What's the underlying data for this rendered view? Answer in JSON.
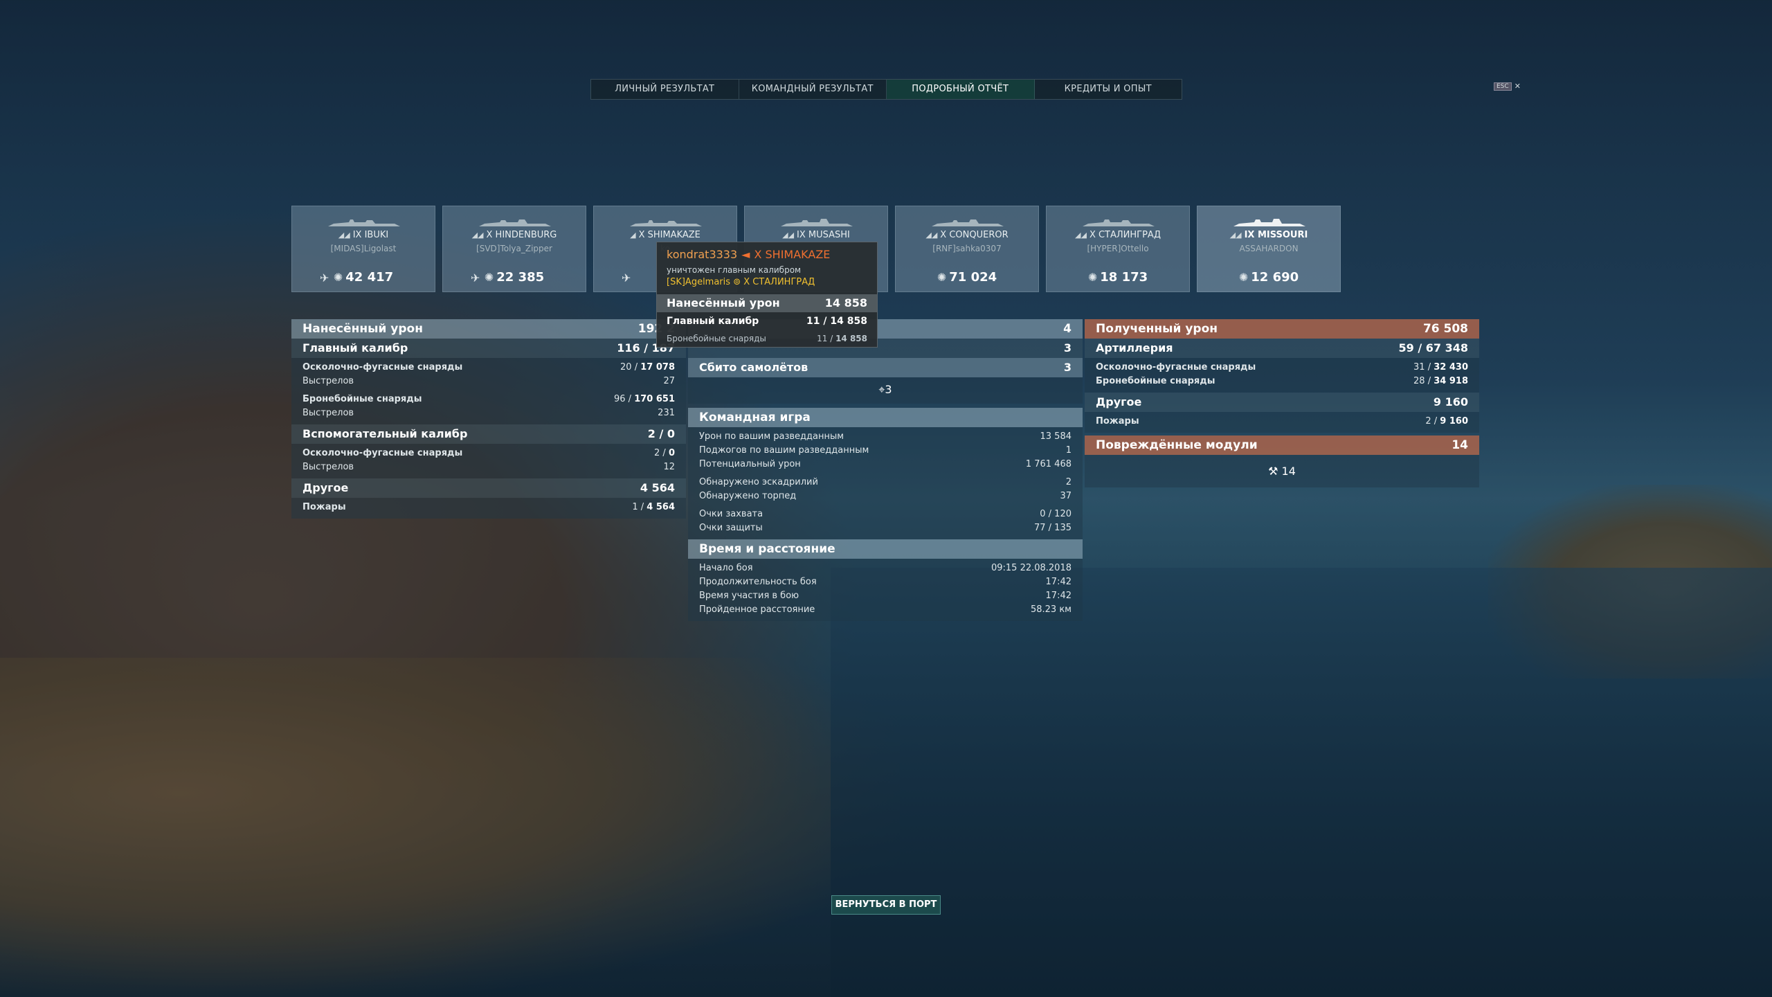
{
  "tabs": [
    "ЛИЧНЫЙ РЕЗУЛЬТАТ",
    "КОМАНДНЫЙ РЕЗУЛЬТАТ",
    "ПОДРОБНЫЙ ОТЧЁТ",
    "КРЕДИТЫ И ОПЫТ"
  ],
  "active_tab": "ПОДРОБНЫЙ ОТЧЁТ",
  "esc": {
    "key": "ESC",
    "close": "✕"
  },
  "ships": [
    {
      "name": "IX IBUKI",
      "player": "[MIDAS]Ligolast",
      "damage": "42 417"
    },
    {
      "name": "X HINDENBURG",
      "player": "[SVD]Tolya_Zipper",
      "damage": "22 385"
    },
    {
      "name": "X SHIMAKAZE",
      "player": "ko",
      "damage": ""
    },
    {
      "name": "IX MUSASHI",
      "player": "",
      "damage": ""
    },
    {
      "name": "X CONQUEROR",
      "player": "[RNF]sahka0307",
      "damage": "71 024"
    },
    {
      "name": "X СТАЛИНГРАД",
      "player": "[HYPER]Ottello",
      "damage": "18 173"
    },
    {
      "name": "IX MISSOURI",
      "player": "ASSAHARDON",
      "damage": "12 690"
    }
  ],
  "dealt": {
    "title": "Нанесённый урон",
    "total": "192 2",
    "main": {
      "label": "Главный калибр",
      "value": "116 / 187"
    },
    "he": {
      "label": "Осколочно-фугасные снаряды",
      "hits": "20",
      "dmg": "17 078"
    },
    "he_shots": {
      "label": "Выстрелов",
      "value": "27"
    },
    "ap": {
      "label": "Бронебойные снаряды",
      "hits": "96",
      "dmg": "170 651"
    },
    "ap_shots": {
      "label": "Выстрелов",
      "value": "231"
    },
    "secondary": {
      "label": "Вспомогательный калибр",
      "value": "2 / 0"
    },
    "sec_he": {
      "label": "Осколочно-фугасные снаряды",
      "hits": "2",
      "dmg": "0"
    },
    "sec_shots": {
      "label": "Выстрелов",
      "value": "12"
    },
    "other": {
      "label": "Другое",
      "value": "4 564"
    },
    "fires": {
      "label": "Пожары",
      "hits": "1",
      "dmg": "4 564"
    }
  },
  "center": {
    "row1_value": "4",
    "row2_value": "3",
    "planes": {
      "label": "Сбито самолётов",
      "value": "3"
    },
    "planes_icon_count": "3",
    "team": {
      "title": "Командная игра",
      "rows": [
        {
          "label": "Урон по вашим разведданным",
          "value": "13 584"
        },
        {
          "label": "Поджогов по вашим разведданным",
          "value": "1"
        },
        {
          "label": "Потенциальный урон",
          "value": "1 761 468"
        },
        {
          "label": "Обнаружено эскадрилий",
          "value": "2"
        },
        {
          "label": "Обнаружено торпед",
          "value": "37"
        },
        {
          "label": "Очки захвата",
          "value": "0 / 120"
        },
        {
          "label": "Очки защиты",
          "value": "77 / 135"
        }
      ]
    },
    "time": {
      "title": "Время и расстояние",
      "rows": [
        {
          "label": "Начало боя",
          "value": "09:15  22.08.2018"
        },
        {
          "label": "Продолжительность боя",
          "value": "17:42"
        },
        {
          "label": "Время участия в бою",
          "value": "17:42"
        },
        {
          "label": "Пройденное расстояние",
          "value": "58.23 км"
        }
      ]
    }
  },
  "received": {
    "title": "Полученный урон",
    "total": "76 508",
    "artillery": {
      "label": "Артиллерия",
      "hits": "59",
      "dmg": "67 348"
    },
    "he": {
      "label": "Осколочно-фугасные снаряды",
      "hits": "31",
      "dmg": "32 430"
    },
    "ap": {
      "label": "Бронебойные снаряды",
      "hits": "28",
      "dmg": "34 918"
    },
    "other": {
      "label": "Другое",
      "value": "9 160"
    },
    "fires": {
      "label": "Пожары",
      "hits": "2",
      "dmg": "9 160"
    },
    "modules": {
      "label": "Повреждённые модули",
      "value": "14"
    },
    "modules_icon_count": "14"
  },
  "tooltip": {
    "killer": "kondrat3333",
    "arrow": "◄",
    "victim": "X SHIMAKAZE",
    "method": "уничтожен главным калибром",
    "mate": "[SK]Agelmaris",
    "mate_ship": "X СТАЛИНГРАД",
    "dmg": {
      "label": "Нанесённый урон",
      "value": "14 858"
    },
    "main": {
      "label": "Главный калибр",
      "hits": "11",
      "dmg": "14 858"
    },
    "ap": {
      "label": "Бронебойные снаряды",
      "hits": "11",
      "dmg": "14 858"
    }
  },
  "port_button": "ВЕРНУТЬСЯ В ПОРТ",
  "colors": {
    "accent_active_tab": "#143c3a",
    "dealt_header": "#96afbe",
    "received_header": "#aa644b",
    "tooltip_killer": "#f0a050",
    "tooltip_victim": "#f07030",
    "tooltip_mate": "#f0c030"
  }
}
